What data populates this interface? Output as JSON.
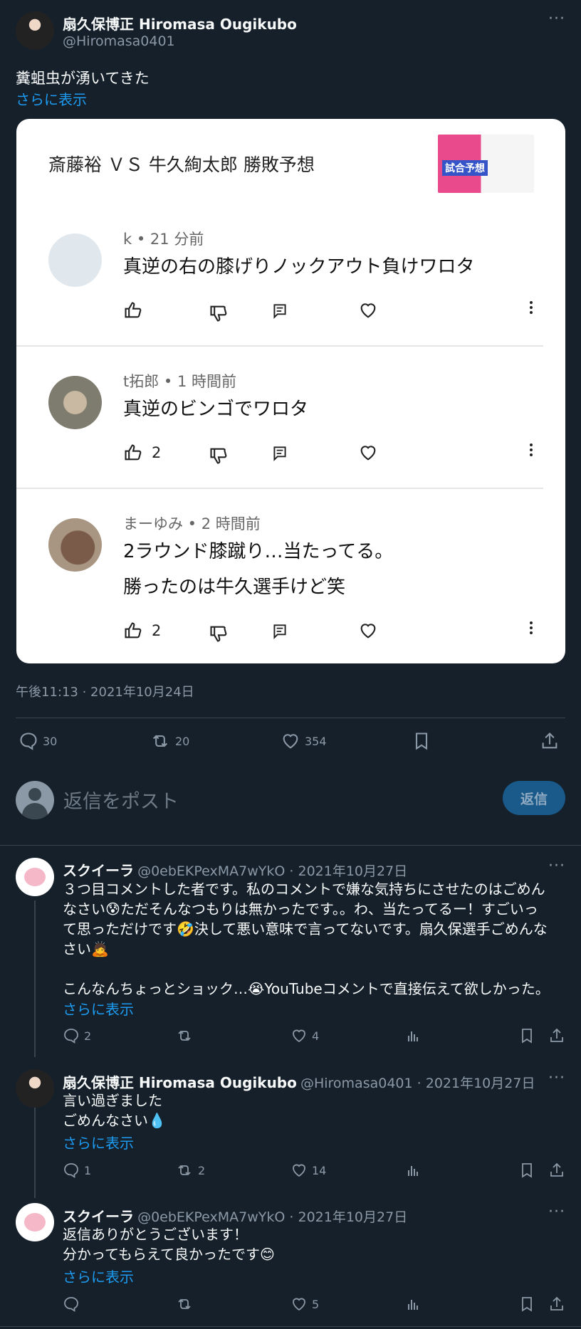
{
  "post": {
    "author_name": "扇久保博正 Hiromasa Ougikubo",
    "author_handle": "@Hiromasa0401",
    "text": "糞蛆虫が湧いてきた",
    "show_more": "さらに表示",
    "timestamp": "午後11:13 · 2021年10月24日",
    "stats": {
      "replies": "30",
      "reposts": "20",
      "likes": "354"
    }
  },
  "card": {
    "title": "斎藤裕 ＶＳ 牛久絢太郎 勝敗予想",
    "thumb_label": "試合予想",
    "comments": [
      {
        "author": "k",
        "time": "21 分前",
        "lines": [
          "真逆の右の膝げりノックアウト負けワロタ"
        ],
        "likes": ""
      },
      {
        "author": "t拓郎",
        "time": "1 時間前",
        "lines": [
          "真逆のビンゴでワロタ"
        ],
        "likes": "2"
      },
      {
        "author": "まーゆみ",
        "time": "2 時間前",
        "lines": [
          "2ラウンド膝蹴り…当たってる。",
          "勝ったのは牛久選手けど笑"
        ],
        "likes": "2"
      }
    ]
  },
  "compose": {
    "placeholder": "返信をポスト",
    "button": "返信"
  },
  "replies": [
    {
      "name": "スクイーラ",
      "handle": "@0ebEKPexMA7wYkO",
      "date": "2021年10月27日",
      "lines": [
        "３つ目コメントした者です。私のコメントで嫌な気持ちにさせたのはごめん",
        "なさい😰ただそんなつもりは無かったです。。わ、当たってるー！すごいっ",
        "て思っただけです🤣決して悪い意味で言ってないです。扇久保選手ごめんな",
        "さい🙇",
        "",
        "こんなんちょっとショック…😭YouTubeコメントで直接伝えて欲しかった。"
      ],
      "show_more": "さらに表示",
      "stats": {
        "replies": "2",
        "reposts": "",
        "likes": "4"
      }
    },
    {
      "name": "扇久保博正 Hiromasa Ougikubo",
      "handle": "@Hiromasa0401",
      "date": "2021年10月27日",
      "lines": [
        "言い過ぎました",
        "ごめんなさい💧"
      ],
      "show_more": "さらに表示",
      "stats": {
        "replies": "1",
        "reposts": "2",
        "likes": "14"
      }
    },
    {
      "name": "スクイーラ",
      "handle": "@0ebEKPexMA7wYkO",
      "date": "2021年10月27日",
      "lines": [
        "返信ありがとうございます！",
        "分かってもらえて良かったです😊"
      ],
      "show_more": "さらに表示",
      "stats": {
        "replies": "",
        "reposts": "",
        "likes": "5"
      }
    }
  ],
  "icons": [
    "more-icon",
    "thumb-up-icon",
    "thumb-down-icon",
    "reply-icon",
    "heart-icon",
    "repost-icon",
    "bookmark-icon",
    "share-icon",
    "views-icon"
  ],
  "colors": {
    "background": "#15202b",
    "accent": "#1d9bf0",
    "muted": "#8b98a5"
  }
}
